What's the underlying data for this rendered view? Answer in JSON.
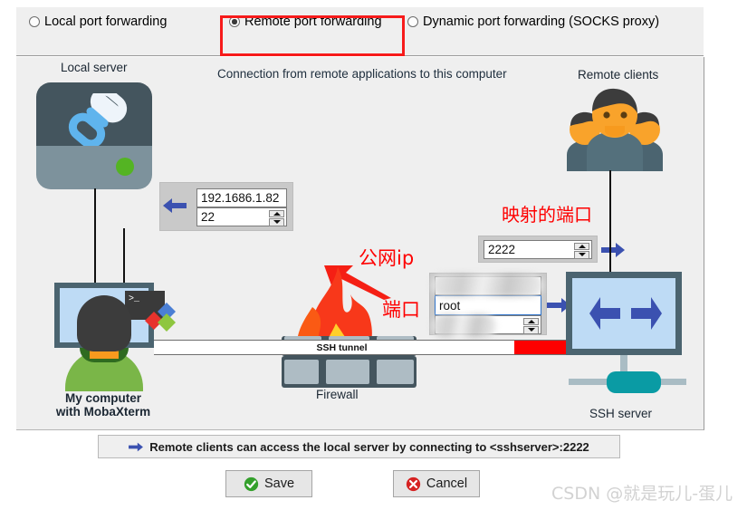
{
  "modes": [
    {
      "label": "Local port forwarding",
      "selected": false,
      "icon": "radio-icon"
    },
    {
      "label": "Remote port forwarding",
      "selected": true,
      "icon": "radio-icon"
    },
    {
      "label": "Dynamic port forwarding (SOCKS proxy)",
      "selected": false,
      "icon": "radio-icon"
    }
  ],
  "diagram": {
    "heading": "Connection from remote applications to this computer",
    "local_server_label": "Local server",
    "remote_clients_label": "Remote clients",
    "firewall_label": "Firewall",
    "ssh_server_label": "SSH server",
    "my_computer_line1": "My computer",
    "my_computer_line2": "with MobaXterm",
    "tunnel_label": "SSH tunnel",
    "forwarded_host": "192.1686.1.82",
    "forwarded_port": "22",
    "mapped_port": "2222",
    "ssh_host": "",
    "ssh_user": "root",
    "ssh_port": "",
    "arrow_left_icon": "arrow-left-icon",
    "arrow_right_icon": "arrow-right-icon"
  },
  "annotations": {
    "mapped_port_note": "映射的端口",
    "public_ip_note": "公网ip",
    "port_note": "端口",
    "note_color": "#fe0000"
  },
  "summary": {
    "arrow_icon": "arrow-right-icon",
    "text": "Remote clients can access the local server by connecting to <sshserver>:2222"
  },
  "buttons": {
    "save_label": "Save",
    "save_icon": "check-circle-icon",
    "cancel_label": "Cancel",
    "cancel_icon": "x-circle-icon"
  },
  "watermark": "CSDN @就是玩儿-蛋儿",
  "colors": {
    "accent_blue": "#3b51b0",
    "red": "#fe0000",
    "panel_bg": "#efefef",
    "server_dark": "#44555e",
    "teal": "#0a9ba4",
    "green_led": "#54b423"
  }
}
